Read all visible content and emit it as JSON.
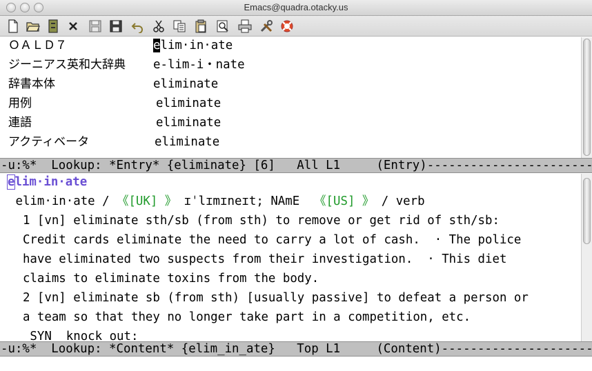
{
  "window": {
    "title": "Emacs@quadra.otacky.us"
  },
  "toolbar": {
    "buttons": [
      {
        "name": "new-file-icon"
      },
      {
        "name": "open-folder-icon"
      },
      {
        "name": "file-cabinet-icon"
      },
      {
        "name": "close-icon"
      },
      {
        "name": "save-icon"
      },
      {
        "name": "save-as-icon"
      },
      {
        "name": "undo-icon"
      },
      {
        "name": "cut-icon"
      },
      {
        "name": "copy-icon"
      },
      {
        "name": "paste-icon"
      },
      {
        "name": "search-icon"
      },
      {
        "name": "print-icon"
      },
      {
        "name": "preferences-icon"
      },
      {
        "name": "help-icon"
      }
    ]
  },
  "entry_buffer": {
    "rows": [
      {
        "dict": "ＯＡＬＤ７",
        "term": "elim·in·ate"
      },
      {
        "dict": "ジーニアス英和大辞典",
        "term": "e-lim-i・nate"
      },
      {
        "dict": "辞書本体",
        "term": "eliminate"
      },
      {
        "dict": "用例",
        "term": "eliminate"
      },
      {
        "dict": "連語",
        "term": "eliminate"
      },
      {
        "dict": "アクティベータ",
        "term": "eliminate"
      }
    ],
    "cursor_char": "e",
    "first_term_rest": "lim·in·ate"
  },
  "modeline_entry": "-u:%*  Lookup: *Entry* {eliminate} [6]   All L1     (Entry)------------------------------",
  "content_buffer": {
    "headword_first": "e",
    "headword_rest": "lim·in·ate",
    "pron_word": " elim·in·ate / ",
    "uk_label": "《[UK] 》",
    "uk_pron": " ɪˈlɪmɪneɪt; NAmE  ",
    "us_label": "《[US] 》",
    "pos": " / verb",
    "lines": [
      "  1 [vn] eliminate sth/sb (from sth) to remove or get rid of sth/sb:",
      "  Credit cards eliminate the need to carry a lot of cash.  · The police",
      "  have eliminated two suspects from their investigation.  · This diet",
      "  claims to eliminate toxins from the body.",
      "  2 [vn] eliminate sb (from sth) [usually passive] to defeat a person or",
      "  a team so that they no longer take part in a competition, etc.",
      "   SYN  knock out:"
    ]
  },
  "modeline_content": "-u:%*  Lookup: *Content* {elim_in_ate}   Top L1     (Content)----------------------------"
}
